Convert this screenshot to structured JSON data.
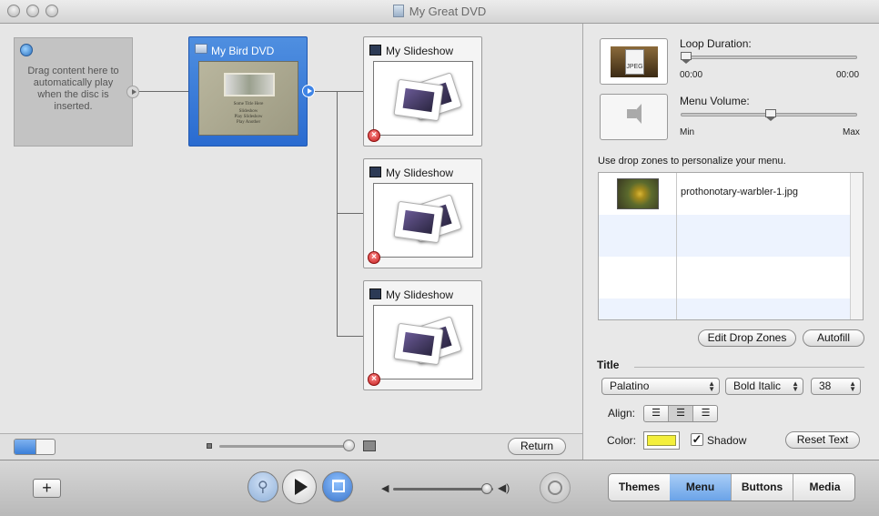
{
  "window": {
    "title": "My Great DVD"
  },
  "map": {
    "autoplay_hint": "Drag content here to automatically play when the disc is inserted.",
    "menu_node": {
      "label": "My Bird DVD",
      "thumb_title": "Some Title Here",
      "thumb_lines": [
        "Slideshow",
        "Play Slideshow",
        "Play Another"
      ]
    },
    "slideshows": [
      {
        "label": "My Slideshow"
      },
      {
        "label": "My Slideshow"
      },
      {
        "label": "My Slideshow"
      }
    ],
    "return_label": "Return"
  },
  "inspector": {
    "loop_duration_label": "Loop Duration:",
    "loop_start": "00:00",
    "loop_end": "00:00",
    "thumb_badge": "JPEG",
    "menu_volume_label": "Menu Volume:",
    "volume_min": "Min",
    "volume_max": "Max",
    "menu_volume_level": 0.51,
    "drop_zones_hint": "Use drop zones to personalize your menu.",
    "drop_zones": [
      {
        "file": "prothonotary-warbler-1.jpg"
      },
      {
        "file": ""
      },
      {
        "file": ""
      },
      {
        "file": ""
      }
    ],
    "edit_drop_zones_label": "Edit Drop Zones",
    "autofill_label": "Autofill",
    "title_section": "Title",
    "font": "Palatino",
    "style": "Bold Italic",
    "size": "38",
    "align_label": "Align:",
    "color_label": "Color:",
    "color_value": "#f4ef3b",
    "shadow_label": "Shadow",
    "shadow_checked": true,
    "reset_text_label": "Reset Text"
  },
  "toolbar": {
    "add_label": "+",
    "tabs": [
      "Themes",
      "Menu",
      "Buttons",
      "Media"
    ],
    "active_tab": "Menu",
    "volume_level": 0.9
  }
}
